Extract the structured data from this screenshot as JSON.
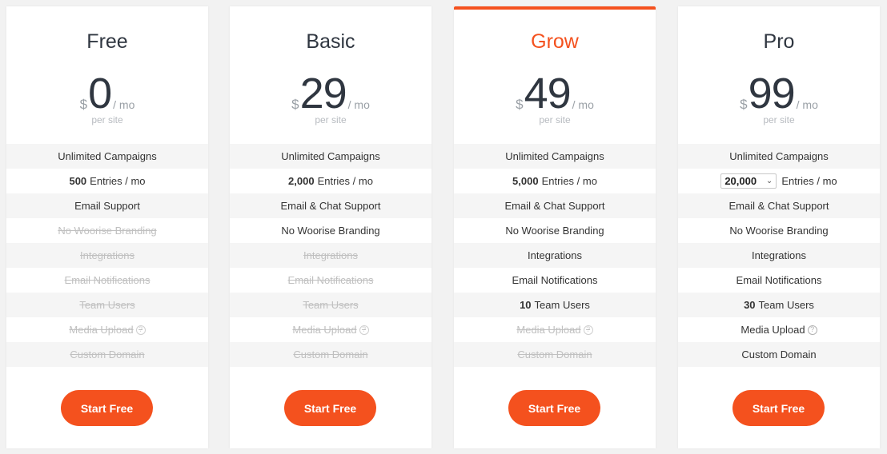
{
  "accent_color": "#f4511e",
  "plans": [
    {
      "name": "Free",
      "currency": "$",
      "amount": "0",
      "period": "/ mo",
      "per_site": "per site",
      "cta": "Start Free",
      "features": {
        "campaigns": "Unlimited Campaigns",
        "entries_value": "500",
        "entries_suffix": "Entries / mo",
        "support": "Email Support",
        "branding": "No Woorise Branding",
        "integrations": "Integrations",
        "notifications": "Email Notifications",
        "team": "Team Users",
        "media": "Media Upload",
        "domain": "Custom Domain"
      }
    },
    {
      "name": "Basic",
      "currency": "$",
      "amount": "29",
      "period": "/ mo",
      "per_site": "per site",
      "cta": "Start Free",
      "features": {
        "campaigns": "Unlimited Campaigns",
        "entries_value": "2,000",
        "entries_suffix": "Entries / mo",
        "support": "Email & Chat Support",
        "branding": "No Woorise Branding",
        "integrations": "Integrations",
        "notifications": "Email Notifications",
        "team": "Team Users",
        "media": "Media Upload",
        "domain": "Custom Domain"
      }
    },
    {
      "name": "Grow",
      "currency": "$",
      "amount": "49",
      "period": "/ mo",
      "per_site": "per site",
      "cta": "Start Free",
      "features": {
        "campaigns": "Unlimited Campaigns",
        "entries_value": "5,000",
        "entries_suffix": "Entries / mo",
        "support": "Email & Chat Support",
        "branding": "No Woorise Branding",
        "integrations": "Integrations",
        "notifications": "Email Notifications",
        "team_value": "10",
        "team": "Team Users",
        "media": "Media Upload",
        "domain": "Custom Domain"
      }
    },
    {
      "name": "Pro",
      "currency": "$",
      "amount": "99",
      "period": "/ mo",
      "per_site": "per site",
      "cta": "Start Free",
      "features": {
        "campaigns": "Unlimited Campaigns",
        "entries_selected": "20,000",
        "entries_suffix": "Entries / mo",
        "support": "Email & Chat Support",
        "branding": "No Woorise Branding",
        "integrations": "Integrations",
        "notifications": "Email Notifications",
        "team_value": "30",
        "team": "Team Users",
        "media": "Media Upload",
        "domain": "Custom Domain"
      }
    }
  ],
  "help_icon_glyph": "?"
}
